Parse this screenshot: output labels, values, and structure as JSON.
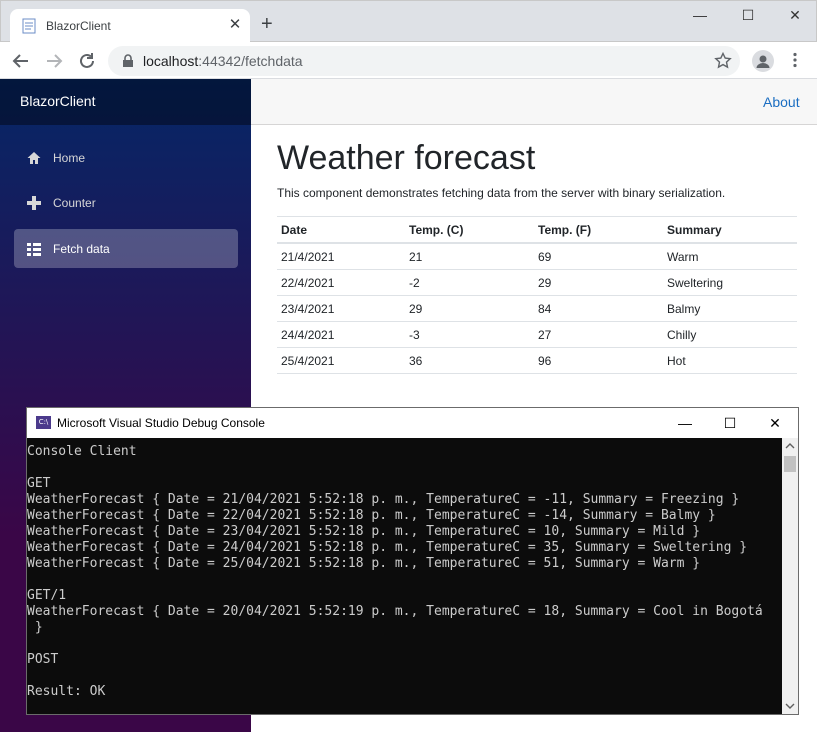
{
  "browser": {
    "tab_title": "BlazorClient",
    "new_tab": "+",
    "url_host": "localhost",
    "url_port_path": ":44342/fetchdata",
    "window_buttons": [
      "—",
      "☐",
      "✕"
    ]
  },
  "sidebar": {
    "brand": "BlazorClient",
    "items": [
      {
        "label": "Home",
        "icon": "home-icon"
      },
      {
        "label": "Counter",
        "icon": "plus-icon"
      },
      {
        "label": "Fetch data",
        "icon": "list-icon",
        "active": true
      }
    ]
  },
  "topbar": {
    "about": "About"
  },
  "page": {
    "title": "Weather forecast",
    "description": "This component demonstrates fetching data from the server with binary serialization.",
    "table": {
      "headers": [
        "Date",
        "Temp. (C)",
        "Temp. (F)",
        "Summary"
      ],
      "rows": [
        [
          "21/4/2021",
          "21",
          "69",
          "Warm"
        ],
        [
          "22/4/2021",
          "-2",
          "29",
          "Sweltering"
        ],
        [
          "23/4/2021",
          "29",
          "84",
          "Balmy"
        ],
        [
          "24/4/2021",
          "-3",
          "27",
          "Chilly"
        ],
        [
          "25/4/2021",
          "36",
          "96",
          "Hot"
        ]
      ]
    }
  },
  "console": {
    "icon_text": "C:\\",
    "title": "Microsoft Visual Studio Debug Console",
    "buttons": [
      "—",
      "☐",
      "✕"
    ],
    "lines": [
      "Console Client",
      "",
      "GET",
      "WeatherForecast { Date = 21/04/2021 5:52:18 p. m., TemperatureC = -11, Summary = Freezing }",
      "WeatherForecast { Date = 22/04/2021 5:52:18 p. m., TemperatureC = -14, Summary = Balmy }",
      "WeatherForecast { Date = 23/04/2021 5:52:18 p. m., TemperatureC = 10, Summary = Mild }",
      "WeatherForecast { Date = 24/04/2021 5:52:18 p. m., TemperatureC = 35, Summary = Sweltering }",
      "WeatherForecast { Date = 25/04/2021 5:52:18 p. m., TemperatureC = 51, Summary = Warm }",
      "",
      "GET/1",
      "WeatherForecast { Date = 20/04/2021 5:52:19 p. m., TemperatureC = 18, Summary = Cool in Bogotá",
      " }",
      "",
      "POST",
      "",
      "Result: OK"
    ]
  }
}
